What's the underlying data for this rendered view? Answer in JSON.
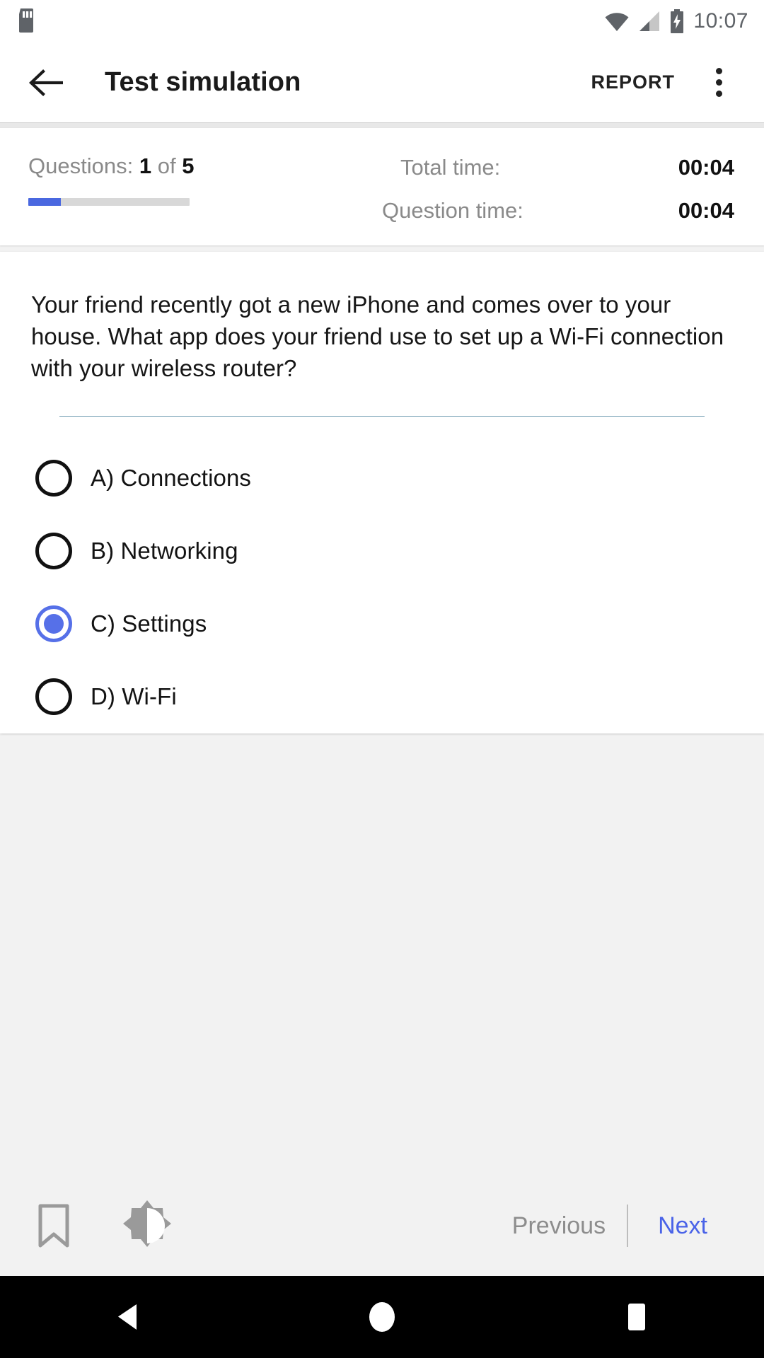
{
  "status_bar": {
    "time": "10:07",
    "icons": [
      "sd-card-icon",
      "wifi-icon",
      "cellular-signal-icon",
      "battery-charging-icon"
    ]
  },
  "app_bar": {
    "back_icon": "arrow-back-icon",
    "title": "Test simulation",
    "report_label": "REPORT",
    "overflow_icon": "more-vert-icon"
  },
  "stats": {
    "questions_label": "Questions:",
    "current_question": "1",
    "of_label": "of",
    "total_questions": "5",
    "progress_percent": 20,
    "progress_color": "#4a68e0",
    "total_time_label": "Total time:",
    "total_time_value": "00:04",
    "question_time_label": "Question time:",
    "question_time_value": "00:04"
  },
  "question": {
    "text": "Your friend recently got a new iPhone and comes over to your house. What app does your friend use to set up a Wi-Fi connection with your wireless router?",
    "divider_color": "#5e8fa8",
    "options": [
      {
        "label": "A) Connections",
        "selected": false
      },
      {
        "label": "B) Networking",
        "selected": false
      },
      {
        "label": "C) Settings",
        "selected": true
      },
      {
        "label": "D) Wi-Fi",
        "selected": false
      }
    ],
    "selected_color": "#5670e8"
  },
  "bottom_bar": {
    "bookmark_icon": "bookmark-icon",
    "brightness_icon": "brightness-contrast-icon",
    "previous_label": "Previous",
    "next_label": "Next",
    "next_color": "#4a63e8",
    "previous_color": "#8d8d8d"
  },
  "nav_bar": {
    "back_icon": "nav-back-triangle-icon",
    "home_icon": "nav-home-circle-icon",
    "recents_icon": "nav-recents-square-icon"
  }
}
